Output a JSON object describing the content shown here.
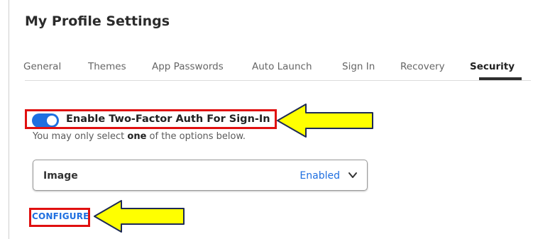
{
  "page": {
    "title": "My Profile Settings"
  },
  "tabs": [
    {
      "label": "General",
      "active": false
    },
    {
      "label": "Themes",
      "active": false
    },
    {
      "label": "App Passwords",
      "active": false
    },
    {
      "label": "Auto Launch",
      "active": false
    },
    {
      "label": "Sign In",
      "active": false
    },
    {
      "label": "Recovery",
      "active": false
    },
    {
      "label": "Security",
      "active": true
    }
  ],
  "two_factor": {
    "enabled": true,
    "label": "Enable Two-Factor Auth For Sign-In",
    "helper_prefix": "You may only select ",
    "helper_emphasis": "one",
    "helper_suffix": " of the options below."
  },
  "option_select": {
    "name": "Image",
    "status": "Enabled",
    "icon": "chevron-down-icon"
  },
  "configure_label": "CONFIGURE",
  "annotations": {
    "arrow_color": "#ffff00",
    "highlight_color": "#e01010"
  },
  "colors": {
    "accent": "#1f6fe0",
    "text": "#2b2b2b",
    "muted": "#666666"
  }
}
